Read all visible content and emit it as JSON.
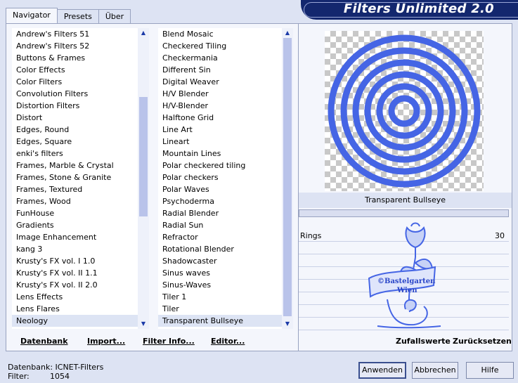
{
  "window": {
    "title": "Filters Unlimited 2.0"
  },
  "tabs": [
    {
      "label": "Navigator"
    },
    {
      "label": "Presets"
    },
    {
      "label": "Über"
    }
  ],
  "categories": [
    "Andrew's Filters 51",
    "Andrew's Filters 52",
    "Buttons & Frames",
    "Color Effects",
    "Color Filters",
    "Convolution Filters",
    "Distortion Filters",
    "Distort",
    "Edges, Round",
    "Edges, Square",
    "enki's filters",
    "Frames, Marble & Crystal",
    "Frames, Stone & Granite",
    "Frames, Textured",
    "Frames, Wood",
    "FunHouse",
    "Gradients",
    "Image Enhancement",
    "kang 3",
    "Krusty's FX vol. I 1.0",
    "Krusty's FX vol. II 1.1",
    "Krusty's FX vol. II 2.0",
    "Lens Effects",
    "Lens Flares",
    "Neology"
  ],
  "selected_category": "Neology",
  "filters": [
    "Blend Mosaic",
    "Checkered Tiling",
    "Checkermania",
    "Different Sin",
    "Digital Weaver",
    "H/V Blender",
    "H/V-Blender",
    "Halftone Grid",
    "Line Art",
    "Lineart",
    "Mountain Lines",
    "Polar checkered tiling",
    "Polar checkers",
    "Polar Waves",
    "Psychoderma",
    "Radial Blender",
    "Radial Sun",
    "Refractor",
    "Rotational Blender",
    "Shadowcaster",
    "Sinus waves",
    "Sinus-Waves",
    "Tiler 1",
    "Tiler",
    "Transparent Bullseye"
  ],
  "selected_filter": "Transparent Bullseye",
  "bottom_links": {
    "database": "Datenbank",
    "import": "Import...",
    "filter_info": "Filter Info...",
    "editor": "Editor..."
  },
  "preview": {
    "filter_name": "Transparent Bullseye",
    "ring_color": "#4565e5"
  },
  "params": [
    {
      "label": "Rings",
      "value": "30"
    }
  ],
  "param_buttons": {
    "random": "Zufallswerte",
    "reset": "Zurücksetzen"
  },
  "watermark": {
    "text": "©Bastelgarten Wien"
  },
  "status": {
    "db_label": "Datenbank:",
    "db_value": "ICNET-Filters",
    "filter_label": "Filter:",
    "filter_value": "1054"
  },
  "buttons": {
    "apply": "Anwenden",
    "cancel": "Abbrechen",
    "help": "Hilfe"
  },
  "colors": {
    "accent": "#13276e",
    "background": "#dde3f3",
    "scroll_thumb": "#b9c3ea"
  }
}
